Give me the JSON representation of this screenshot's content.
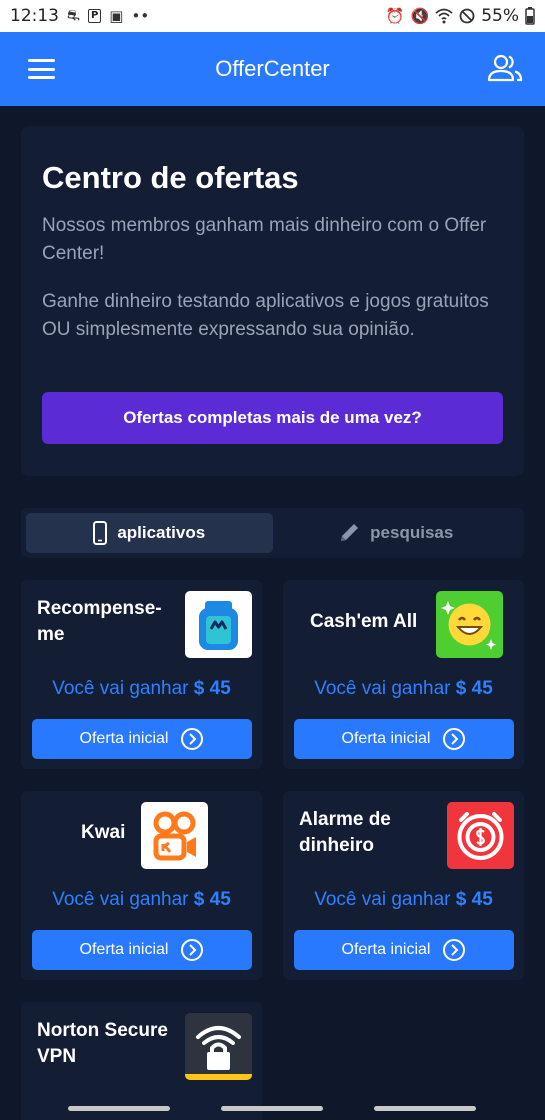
{
  "status_bar": {
    "time": "12:13",
    "battery": "55%"
  },
  "app_bar": {
    "title": "OfferCenter"
  },
  "hero": {
    "heading": "Centro de ofertas",
    "paragraph1": "Nossos membros ganham mais dinheiro com o Offer Center!",
    "paragraph2": "Ganhe dinheiro testando aplicativos e jogos gratuitos OU simplesmente expressando sua opinião.",
    "cta_label": "Ofertas completas mais de uma vez?"
  },
  "tabs": [
    {
      "label": "aplicativos",
      "icon": "phone-icon",
      "active": true
    },
    {
      "label": "pesquisas",
      "icon": "pencil-icon",
      "active": false
    }
  ],
  "offer_prefix": "Você vai ganhar",
  "offers": [
    {
      "name": "Recompense-me",
      "reward": "$ 45",
      "button": "Oferta inicial",
      "icon": "backpack-icon"
    },
    {
      "name": "Cash'em All",
      "reward": "$ 45",
      "button": "Oferta inicial",
      "icon": "smiley-icon"
    },
    {
      "name": "Kwai",
      "reward": "$ 45",
      "button": "Oferta inicial",
      "icon": "kwai-logo-icon"
    },
    {
      "name": "Alarme de dinheiro",
      "reward": "$ 45",
      "button": "Oferta inicial",
      "icon": "alarm-money-icon"
    },
    {
      "name": "Norton Secure VPN",
      "icon": "wifi-lock-icon"
    }
  ],
  "colors": {
    "app_bar": "#2979ff",
    "background": "#0f172a",
    "card": "#131d33",
    "cta": "#5b2bd6",
    "reward_text": "#2f80ff"
  }
}
